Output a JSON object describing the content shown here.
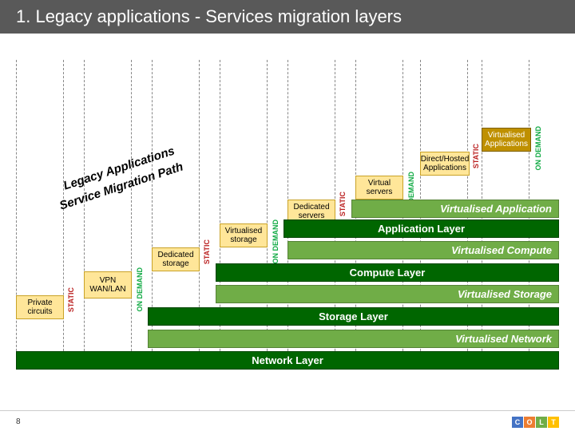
{
  "title": "1. Legacy applications - Services migration layers",
  "diag1": "Legacy Applications",
  "diag2": "Service Migration Path",
  "labels": {
    "static": "STATIC",
    "ondemand": "ON DEMAND"
  },
  "boxes": {
    "private_circuits": "Private circuits",
    "vpn": "VPN WAN/LAN",
    "dedicated_storage": "Dedicated storage",
    "virtualised_storage": "Virtualised storage",
    "dedicated_servers": "Dedicated servers",
    "virtual_servers": "Virtual servers",
    "direct_hosted": "Direct/Hosted Applications",
    "virtualised_apps": "Virtualised Applications"
  },
  "layers": {
    "network": "Network Layer",
    "storage": "Storage Layer",
    "compute": "Compute Layer",
    "application": "Application Layer"
  },
  "virt": {
    "network": "Virtualised Network",
    "storage": "Virtualised Storage",
    "compute": "Virtualised Compute",
    "application": "Virtualised Application"
  },
  "page": "8",
  "logo_letters": [
    "C",
    "O",
    "L",
    "T"
  ],
  "logo_colors": [
    "#4472c4",
    "#ed7d31",
    "#a5a5a5",
    "#ffc000"
  ]
}
